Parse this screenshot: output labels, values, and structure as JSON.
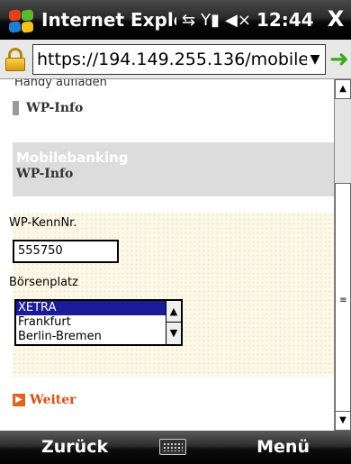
{
  "titlebar": {
    "app_title": "Internet Explor",
    "time": "12:44",
    "close_glyph": "X",
    "icons": [
      "windows-start-icon",
      "network-sync-icon",
      "signal-strength-icon",
      "speaker-muted-icon"
    ]
  },
  "address": {
    "url": "https://194.149.255.136/mobile",
    "dropdown_glyph": "▼",
    "go_glyph": "➜"
  },
  "page": {
    "cut_off_text": "Handy aufladen",
    "wp_link": "WP-Info",
    "section_title": "Mobilebanking",
    "section_subtitle": "WP-Info",
    "kenn_label": "WP-KennNr.",
    "kenn_value": "555750",
    "boerse_label": "Börsenplatz",
    "boerse_options": [
      "XETRA",
      "Frankfurt",
      "Berlin-Bremen"
    ],
    "boerse_selected": "XETRA",
    "weiter_link": "Weiter"
  },
  "softkeys": {
    "left": "Zurück",
    "right": "Menü"
  },
  "colors": {
    "accent_orange": "#d94e10",
    "selection_blue": "#1c1c9a",
    "form_background": "#fbf8e8",
    "section_gray": "#dcdcdc"
  }
}
